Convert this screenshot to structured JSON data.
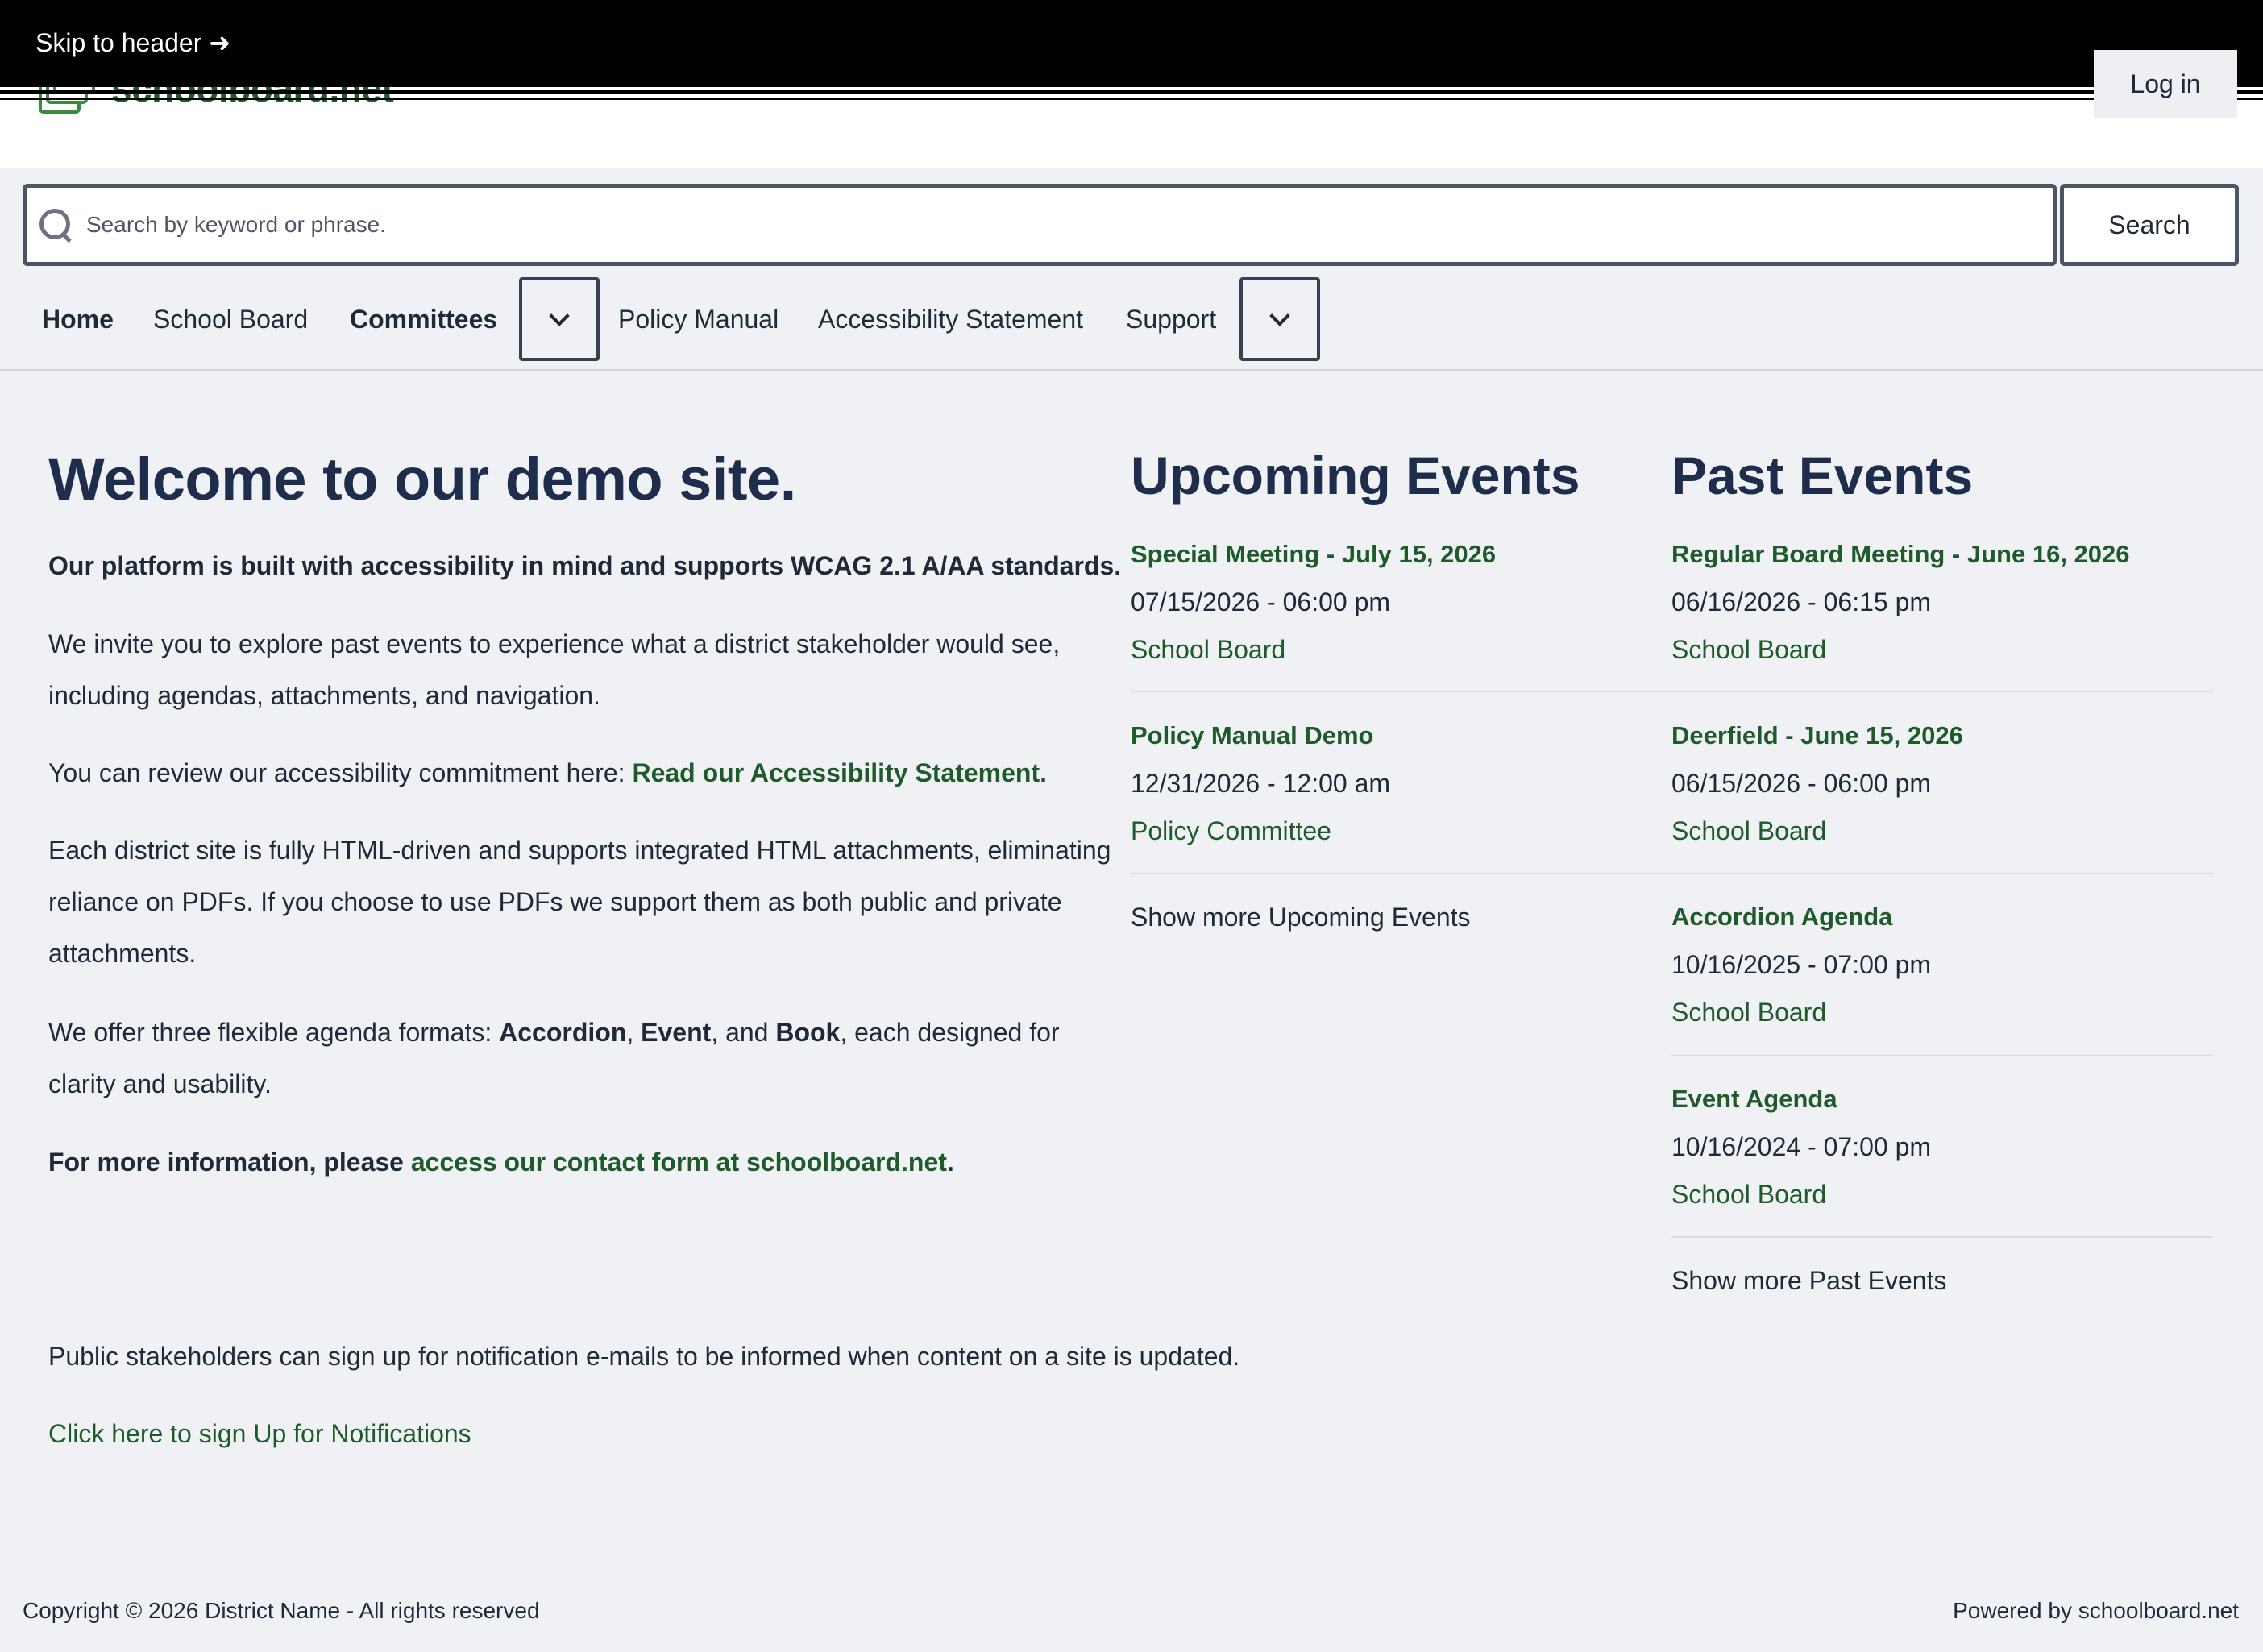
{
  "header": {
    "skip_link": "Skip to header ➜",
    "logo_text": "schoolboard.net",
    "login_label": "Log in"
  },
  "search": {
    "placeholder": "Search by keyword or phrase.",
    "button_label": "Search"
  },
  "nav": {
    "items": [
      {
        "label": "Home"
      },
      {
        "label": "School Board"
      },
      {
        "label": "Committees"
      },
      {
        "label": "Policy Manual"
      },
      {
        "label": "Accessibility Statement"
      },
      {
        "label": "Support"
      }
    ]
  },
  "welcome": {
    "title": "Welcome to our demo site.",
    "p1": "Our platform is built with accessibility in mind and supports WCAG 2.1 A/AA standards.",
    "p2": "We invite you to explore past events to experience what a district stakeholder would see, including agendas, attachments, and navigation.",
    "p3_prefix": "You can review our accessibility commitment here: ",
    "p3_link": "Read our Accessibility Statement.",
    "p4": "Each district site is fully HTML-driven and supports integrated HTML attachments, eliminating reliance on PDFs. If you choose to use PDFs we support them as both public and private attachments.",
    "p5_prefix": "We offer three flexible agenda formats: ",
    "p5_f1": "Accordion",
    "p5_sep1": ", ",
    "p5_f2": "Event",
    "p5_sep2": ", and ",
    "p5_f3": "Book",
    "p5_suffix": ", each designed for clarity and usability.",
    "p6_prefix": "For more information, please ",
    "p6_link": "access our contact form at schoolboard.net",
    "p6_suffix": ".",
    "notify_text": "Public stakeholders can sign up for notification e-mails to be informed when content on a site is updated.",
    "notify_link": "Click here to sign Up for Notifications"
  },
  "upcoming": {
    "title": "Upcoming Events",
    "events": [
      {
        "title": "Special Meeting - July 15, 2026",
        "date": "07/15/2026 - 06:00 pm",
        "committee": "School Board"
      },
      {
        "title": "Policy Manual Demo",
        "date": "12/31/2026 - 12:00 am",
        "committee": "Policy Committee"
      }
    ],
    "show_more": "Show more Upcoming Events"
  },
  "past": {
    "title": "Past Events",
    "events": [
      {
        "title": "Regular Board Meeting - June 16, 2026",
        "date": "06/16/2026 - 06:15 pm",
        "committee": "School Board"
      },
      {
        "title": "Deerfield - June 15, 2026",
        "date": "06/15/2026 - 06:00 pm",
        "committee": "School Board"
      },
      {
        "title": "Accordion Agenda",
        "date": "10/16/2025 - 07:00 pm",
        "committee": "School Board"
      },
      {
        "title": "Event Agenda",
        "date": "10/16/2024 - 07:00 pm",
        "committee": "School Board"
      }
    ],
    "show_more": "Show more Past Events"
  },
  "footer": {
    "copyright": "Copyright © 2026 District Name - All rights reserved",
    "powered": "Powered by schoolboard.net"
  },
  "colors": {
    "heading": "#1f2d4d",
    "link_green": "#1e5a2a",
    "background": "#f0f1f5"
  }
}
